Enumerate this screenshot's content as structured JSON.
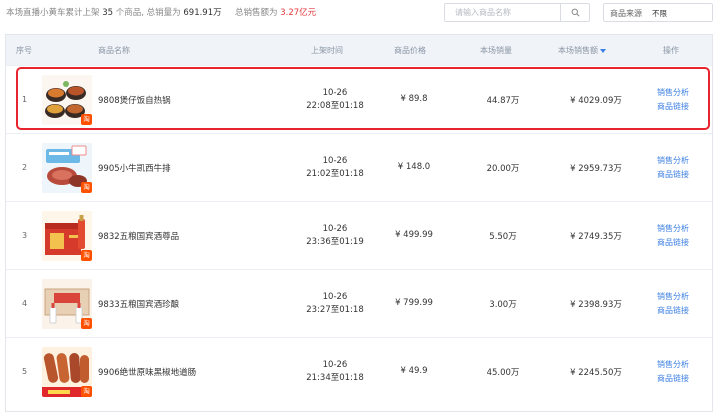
{
  "summary": {
    "prefix": "本场直播小黄车累计上架",
    "count": "35",
    "count_suffix": "个商品,",
    "sales_label": "总销量为",
    "sales_value": "691.91万",
    "amount_label": "总销售额为",
    "amount_value": "3.27亿元"
  },
  "search": {
    "placeholder": "请输入商品名称"
  },
  "source": {
    "label": "商品来源",
    "value": "不限"
  },
  "table": {
    "headers": {
      "index": "序号",
      "name": "商品名称",
      "time": "上架时间",
      "price": "商品价格",
      "sales": "本场销量",
      "amount": "本场销售额",
      "ops": "操作"
    },
    "sorted_column": "amount",
    "op_labels": {
      "analysis": "销售分析",
      "link": "商品链接"
    },
    "rows": [
      {
        "index": "1",
        "name": "9808煲仔饭自热锅",
        "date": "10-26",
        "time": "22:08至01:18",
        "price": "¥ 89.8",
        "sales": "44.87万",
        "amount": "¥ 4029.09万",
        "thumb": "hotpot-bowls",
        "highlighted": true
      },
      {
        "index": "2",
        "name": "9905小牛凯西牛排",
        "date": "10-26",
        "time": "21:02至01:18",
        "price": "¥ 148.0",
        "sales": "20.00万",
        "amount": "¥ 2959.73万",
        "thumb": "steak-box",
        "highlighted": false
      },
      {
        "index": "3",
        "name": "9832五粮国宾酒尊品",
        "date": "10-26",
        "time": "23:36至01:19",
        "price": "¥ 499.99",
        "sales": "5.50万",
        "amount": "¥ 2749.35万",
        "thumb": "liquor-gift-box",
        "highlighted": false
      },
      {
        "index": "4",
        "name": "9833五粮国宾酒珍酿",
        "date": "10-26",
        "time": "23:27至01:18",
        "price": "¥ 799.99",
        "sales": "3.00万",
        "amount": "¥ 2398.93万",
        "thumb": "liquor-bottles",
        "highlighted": false
      },
      {
        "index": "5",
        "name": "9906绝世原味黑椒地道肠",
        "date": "10-26",
        "time": "21:34至01:18",
        "price": "¥ 49.9",
        "sales": "45.00万",
        "amount": "¥ 2245.50万",
        "thumb": "sausages",
        "highlighted": false
      }
    ]
  },
  "badge_text": "淘",
  "colors": {
    "accent": "#3b7fe4",
    "highlight": "#e8242f",
    "red_value": "#e4393c",
    "badge": "#ff5000"
  }
}
